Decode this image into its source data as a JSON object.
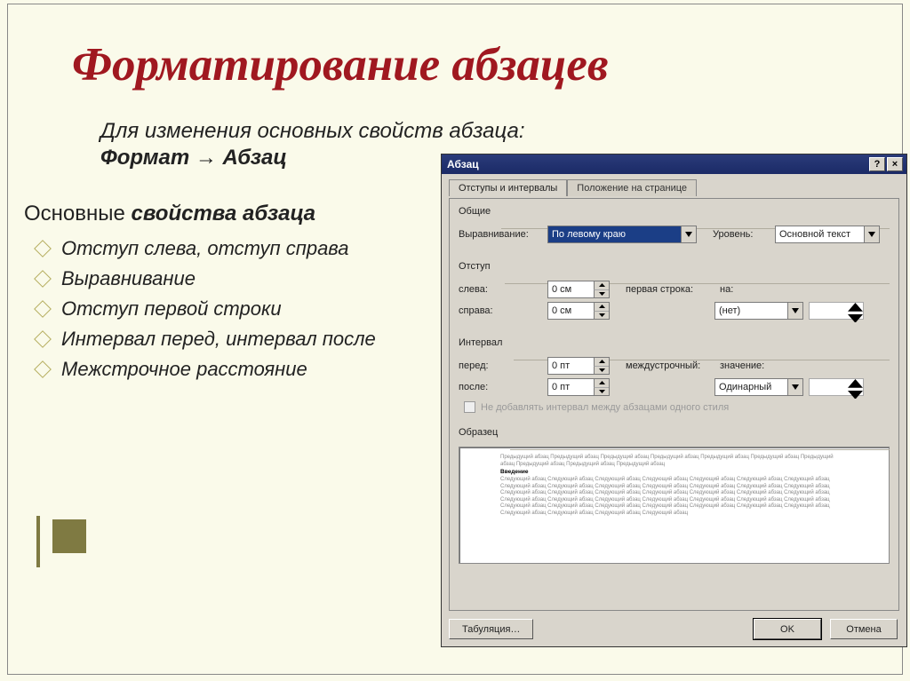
{
  "slide": {
    "title": "Форматирование абзацев",
    "subtitle_line1": "Для изменения основных свойств абзаца:",
    "subtitle_line2": "Формат → Абзац",
    "subhead_a": "Основные ",
    "subhead_b": "свойства абзаца",
    "bullets": [
      "Отступ слева, отступ справа",
      "Выравнивание",
      "Отступ первой строки",
      "Интервал перед, интервал после",
      "Межстрочное расстояние"
    ]
  },
  "dialog": {
    "title": "Абзац",
    "tabs": {
      "t1": "Отступы и интервалы",
      "t2": "Положение на странице"
    },
    "groups": {
      "general": "Общие",
      "indent": "Отступ",
      "interval": "Интервал",
      "preview": "Образец"
    },
    "labels": {
      "align": "Выравнивание:",
      "level": "Уровень:",
      "left": "слева:",
      "right": "справа:",
      "first": "первая строка:",
      "by": "на:",
      "before": "перед:",
      "after": "после:",
      "linespace": "междустрочный:",
      "value": "значение:"
    },
    "values": {
      "align": "По левому краю",
      "level": "Основной текст",
      "left": "0 см",
      "right": "0 см",
      "first": "(нет)",
      "before": "0 пт",
      "after": "0 пт",
      "linespace": "Одинарный"
    },
    "checkbox": "Не добавлять интервал между абзацами одного стиля",
    "buttons": {
      "tabs": "Табуляция…",
      "ok": "OK",
      "cancel": "Отмена"
    },
    "titlebuttons": {
      "help": "?",
      "close": "×"
    }
  }
}
